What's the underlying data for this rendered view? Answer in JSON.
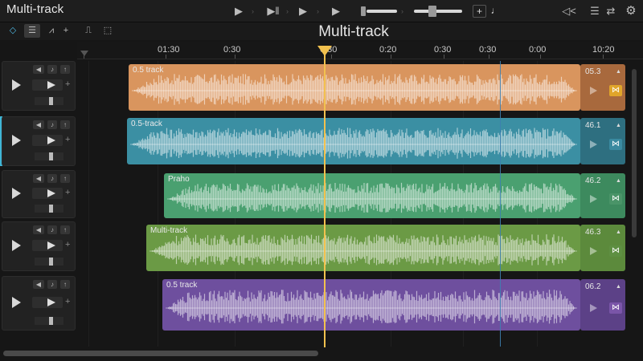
{
  "app": {
    "title": "Multi-track",
    "view_title": "Multi-track"
  },
  "titlebar": {
    "transport": [
      {
        "name": "skip-back-button",
        "glyph": "▶"
      },
      {
        "name": "play-pause-button",
        "glyph": "▶‖"
      },
      {
        "name": "play-button",
        "glyph": "▶"
      },
      {
        "name": "play-forward-button",
        "glyph": "▶"
      }
    ],
    "plus_label": "+",
    "tempo_label": "♩",
    "rewind_glyph": "◁<",
    "menu_glyph": "☰",
    "swap_glyph": "⇄",
    "settings_glyph": "⚙"
  },
  "toolbar": {
    "tools": [
      {
        "name": "select-tool",
        "glyph": "◇"
      },
      {
        "name": "list-tool",
        "glyph": "☰",
        "active": true
      },
      {
        "name": "split-tool",
        "glyph": "⩘"
      },
      {
        "name": "add-tool",
        "glyph": "+"
      },
      {
        "name": "marker-tool",
        "glyph": "⎍"
      },
      {
        "name": "export-tool",
        "glyph": "⬚"
      }
    ]
  },
  "ruler": {
    "labels": [
      "01:30",
      "0:30",
      "0:30",
      "0:20",
      "0:30",
      "0:30",
      "0:00",
      "10:20"
    ]
  },
  "tracks": [
    {
      "clip_label": "0.5 track",
      "tail_label": "05.3",
      "color": "#d9955e",
      "tail_color": "#a8693d",
      "button_color": "#e0a52a",
      "button_glyph": "⋈",
      "mini_right": "↑"
    },
    {
      "clip_label": "0.5-track",
      "tail_label": "46.1",
      "color": "#3b8fa3",
      "tail_color": "#2e6f80",
      "button_color": "#3a8aa0",
      "button_glyph": "⋈",
      "mini_right": "↑"
    },
    {
      "clip_label": "Praho",
      "tail_label": "46.2",
      "color": "#4aa070",
      "tail_color": "#3d8a5e",
      "button_color": "#4a9468",
      "button_glyph": "⋈",
      "mini_right": "↑"
    },
    {
      "clip_label": "Multi-track",
      "tail_label": "46.3",
      "color": "#6b9a45",
      "tail_color": "#5c8a3c",
      "button_color": "#5e8f42",
      "button_glyph": "⋈",
      "mini_right": "↑"
    },
    {
      "clip_label": "0.5 track",
      "tail_label": "06.2",
      "color": "#6e4f9e",
      "tail_color": "#5c4187",
      "button_color": "#7a55a8",
      "button_glyph": "⋈",
      "mini_right": "↑"
    }
  ]
}
